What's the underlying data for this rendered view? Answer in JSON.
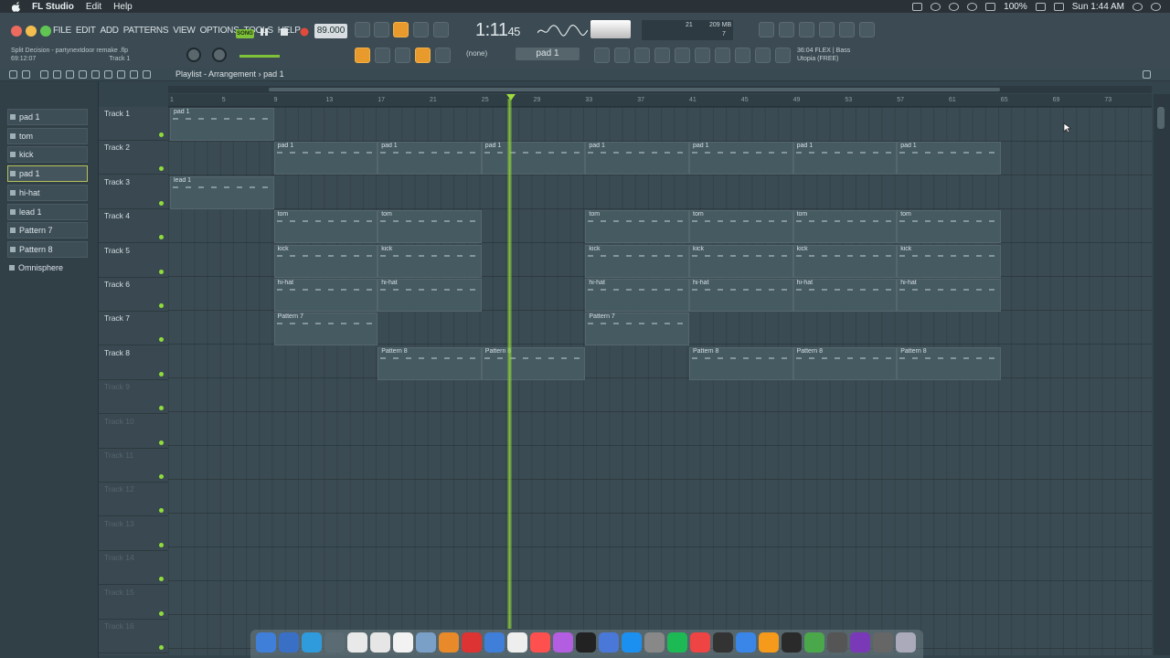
{
  "menubar": {
    "app": "FL Studio",
    "items": [
      "Edit",
      "Help"
    ],
    "battery": "100%",
    "clock": "Sun 1:44 AM"
  },
  "toolbar": {
    "menus": [
      "FILE",
      "EDIT",
      "ADD",
      "PATTERNS",
      "VIEW",
      "OPTIONS",
      "TOOLS",
      "HELP"
    ],
    "project_hint": "Split Decision - partynextdoor remake .flp",
    "track_hint": "Track 1",
    "time_hint": "69:12:07",
    "song_mode": "SONG",
    "tempo": "89.000",
    "time": "1:11",
    "time_ticks": "45",
    "pattern": "pad 1",
    "arp": "(none)",
    "cpu": "21",
    "mem": "209 MB",
    "poly": "7",
    "plugin_line1": "36:04 FLEX | Bass",
    "plugin_line2": "Utopia (FREE)"
  },
  "window": {
    "title": "Playlist - Arrangement",
    "title_sep": "›",
    "pattern": "pad 1"
  },
  "browser": {
    "items": [
      {
        "label": "pad 1"
      },
      {
        "label": "tom"
      },
      {
        "label": "kick"
      },
      {
        "label": "pad 1",
        "selected": true
      },
      {
        "label": "hi-hat"
      },
      {
        "label": "lead 1"
      },
      {
        "label": "Pattern 7"
      },
      {
        "label": "Pattern 8"
      },
      {
        "label": "Omnisphere"
      }
    ]
  },
  "tracks": [
    "Track 1",
    "Track 2",
    "Track 3",
    "Track 4",
    "Track 5",
    "Track 6",
    "Track 7",
    "Track 8",
    "Track 9",
    "Track 10",
    "Track 11",
    "Track 12",
    "Track 13",
    "Track 14",
    "Track 15",
    "Track 16"
  ],
  "ruler": [
    "1",
    "5",
    "9",
    "13",
    "17",
    "21",
    "25",
    "29",
    "33",
    "37",
    "41",
    "45",
    "49",
    "53",
    "57",
    "61",
    "65",
    "69",
    "73"
  ],
  "clips": [
    {
      "track": 0,
      "start": 1,
      "len": 8,
      "label": "pad 1"
    },
    {
      "track": 1,
      "start": 9,
      "len": 8,
      "label": "pad 1"
    },
    {
      "track": 1,
      "start": 17,
      "len": 8,
      "label": "pad 1"
    },
    {
      "track": 1,
      "start": 25,
      "len": 8,
      "label": "pad 1"
    },
    {
      "track": 1,
      "start": 33,
      "len": 8,
      "label": "pad 1"
    },
    {
      "track": 1,
      "start": 41,
      "len": 8,
      "label": "pad 1"
    },
    {
      "track": 1,
      "start": 49,
      "len": 8,
      "label": "pad 1"
    },
    {
      "track": 1,
      "start": 57,
      "len": 8,
      "label": "pad 1"
    },
    {
      "track": 2,
      "start": 1,
      "len": 8,
      "label": "lead 1"
    },
    {
      "track": 3,
      "start": 9,
      "len": 8,
      "label": "tom"
    },
    {
      "track": 3,
      "start": 17,
      "len": 8,
      "label": "tom"
    },
    {
      "track": 3,
      "start": 33,
      "len": 8,
      "label": "tom"
    },
    {
      "track": 3,
      "start": 41,
      "len": 8,
      "label": "tom"
    },
    {
      "track": 3,
      "start": 49,
      "len": 8,
      "label": "tom"
    },
    {
      "track": 3,
      "start": 57,
      "len": 8,
      "label": "tom"
    },
    {
      "track": 4,
      "start": 9,
      "len": 8,
      "label": "kick"
    },
    {
      "track": 4,
      "start": 17,
      "len": 8,
      "label": "kick"
    },
    {
      "track": 4,
      "start": 33,
      "len": 8,
      "label": "kick"
    },
    {
      "track": 4,
      "start": 41,
      "len": 8,
      "label": "kick"
    },
    {
      "track": 4,
      "start": 49,
      "len": 8,
      "label": "kick"
    },
    {
      "track": 4,
      "start": 57,
      "len": 8,
      "label": "kick"
    },
    {
      "track": 5,
      "start": 9,
      "len": 8,
      "label": "hi-hat"
    },
    {
      "track": 5,
      "start": 17,
      "len": 8,
      "label": "hi-hat"
    },
    {
      "track": 5,
      "start": 33,
      "len": 8,
      "label": "hi-hat"
    },
    {
      "track": 5,
      "start": 41,
      "len": 8,
      "label": "hi-hat"
    },
    {
      "track": 5,
      "start": 49,
      "len": 8,
      "label": "hi-hat"
    },
    {
      "track": 5,
      "start": 57,
      "len": 8,
      "label": "hi-hat"
    },
    {
      "track": 6,
      "start": 9,
      "len": 8,
      "label": "Pattern 7"
    },
    {
      "track": 6,
      "start": 33,
      "len": 8,
      "label": "Pattern 7"
    },
    {
      "track": 7,
      "start": 17,
      "len": 8,
      "label": "Pattern 8"
    },
    {
      "track": 7,
      "start": 25,
      "len": 8,
      "label": "Pattern 8"
    },
    {
      "track": 7,
      "start": 41,
      "len": 8,
      "label": "Pattern 8"
    },
    {
      "track": 7,
      "start": 49,
      "len": 8,
      "label": "Pattern 8"
    },
    {
      "track": 7,
      "start": 57,
      "len": 8,
      "label": "Pattern 8"
    }
  ],
  "playhead_bar": 27,
  "colors": {
    "accent": "#7fc23a",
    "orange": "#e89a2c"
  }
}
